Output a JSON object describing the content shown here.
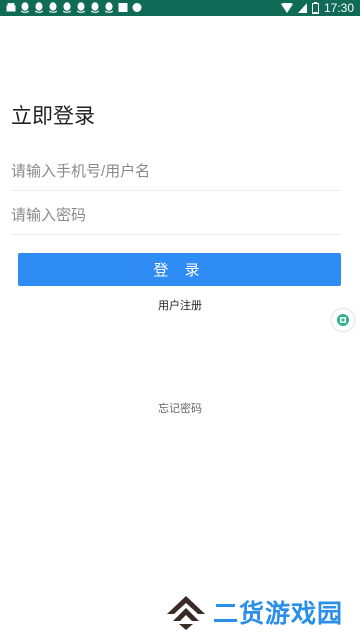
{
  "status_bar": {
    "time": "17:30",
    "battery_level": 1,
    "colors": {
      "background": "#0f6b56"
    },
    "notification_icons": [
      "android-icon",
      "qq-icon",
      "qq-icon",
      "qq-icon",
      "qq-icon",
      "qq-icon",
      "qq-icon",
      "qq-icon",
      "image-icon",
      "circle-icon"
    ]
  },
  "login": {
    "title": "立即登录",
    "username_placeholder": "请输入手机号/用户名",
    "password_placeholder": "请输入密码",
    "login_button": "登 录",
    "register_link": "用户注册",
    "forgot_link": "忘记密码"
  },
  "watermark": {
    "text": "二货游戏园",
    "icon": "logo-chevron-icon"
  },
  "colors": {
    "accent": "#2f8cf4",
    "watermark_text": "#2a8fe9",
    "watermark_logo": "#3a2b26"
  }
}
